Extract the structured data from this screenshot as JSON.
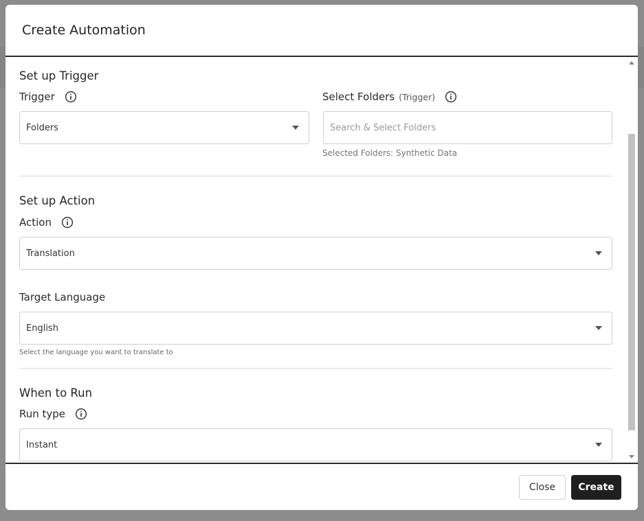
{
  "modal": {
    "title": "Create Automation",
    "trigger_section": {
      "title": "Set up Trigger",
      "trigger_label": "Trigger",
      "trigger_value": "Folders",
      "folders_label": "Select Folders",
      "folders_label_sub": "(Trigger)",
      "folders_placeholder": "Search & Select Folders",
      "selected_folders": "Selected Folders: Synthetic Data"
    },
    "action_section": {
      "title": "Set up Action",
      "action_label": "Action",
      "action_value": "Translation",
      "target_language_label": "Target Language",
      "target_language_value": "English",
      "target_language_helper": "Select the language you want to translate to"
    },
    "run_section": {
      "title": "When to Run",
      "run_type_label": "Run type",
      "run_type_value": "Instant"
    },
    "footer": {
      "close_label": "Close",
      "create_label": "Create"
    }
  },
  "colors": {
    "primary_button": "#1f1f1f",
    "overlay": "#8a8a8a",
    "border": "#cfcfcf"
  },
  "icons": [
    "info-icon",
    "chevron-down-icon"
  ]
}
